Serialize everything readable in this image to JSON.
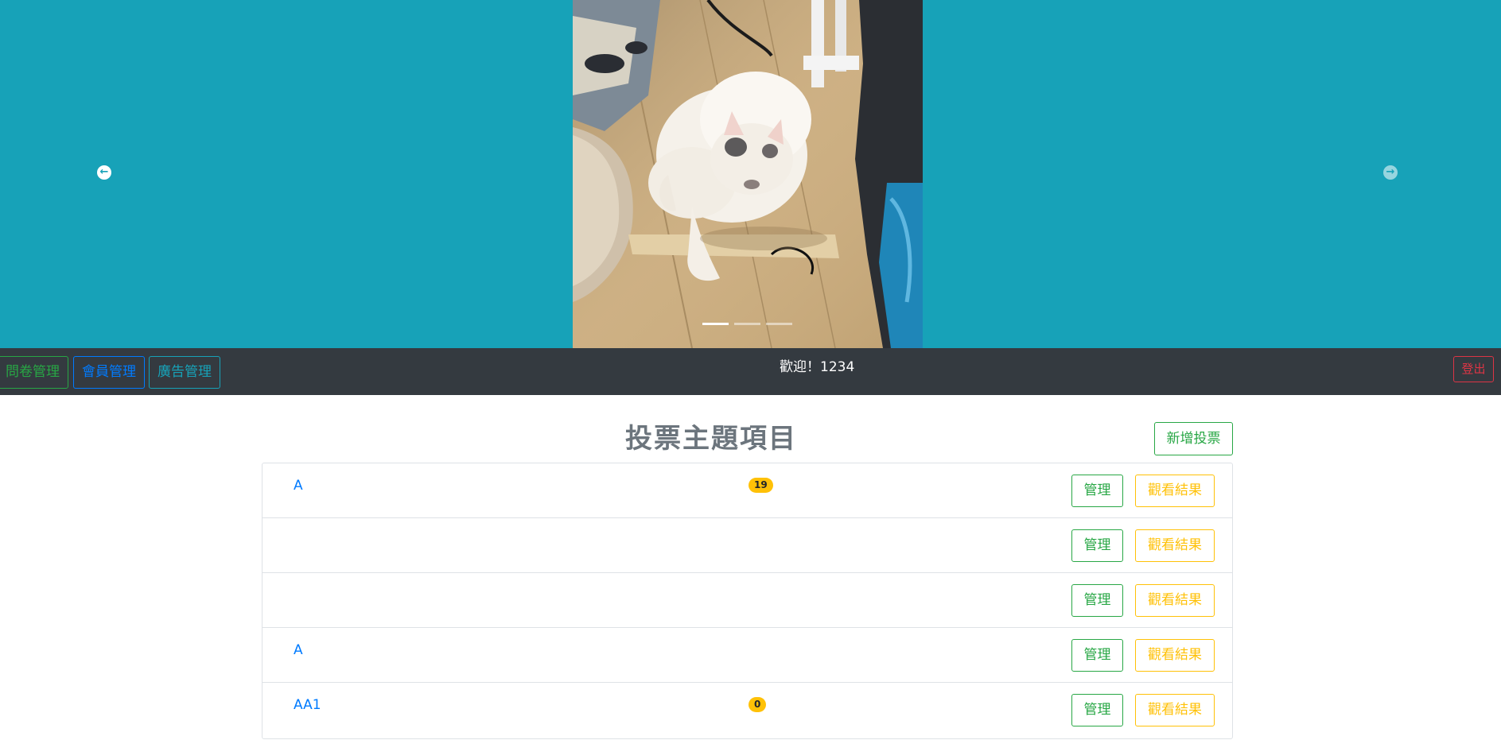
{
  "carousel": {
    "prev_icon": "arrow-left-circle-icon",
    "next_icon": "arrow-right-circle-icon",
    "prev_glyph": "←",
    "next_glyph": "→",
    "slide_count": 3,
    "active_slide": 1,
    "background": "#17a2b8"
  },
  "nav": {
    "survey_label": "問卷管理",
    "member_label": "會員管理",
    "ads_label": "廣告管理",
    "welcome": "歡迎！1234",
    "logout_label": "登出",
    "background": "#343a40"
  },
  "main": {
    "title": "投票主題項目",
    "add_label": "新增投票",
    "items": [
      {
        "title": "A",
        "count": "19",
        "manage_label": "管理",
        "result_label": "觀看結果"
      },
      {
        "title": "",
        "count": "",
        "manage_label": "管理",
        "result_label": "觀看結果"
      },
      {
        "title": "",
        "count": "",
        "manage_label": "管理",
        "result_label": "觀看結果"
      },
      {
        "title": "A",
        "count": "",
        "manage_label": "管理",
        "result_label": "觀看結果"
      },
      {
        "title": "AA1",
        "count": "0",
        "manage_label": "管理",
        "result_label": "觀看結果"
      }
    ]
  },
  "colors": {
    "success": "#28a745",
    "primary": "#007bff",
    "info": "#17a2b8",
    "warning": "#ffc107",
    "danger": "#dc3545"
  }
}
